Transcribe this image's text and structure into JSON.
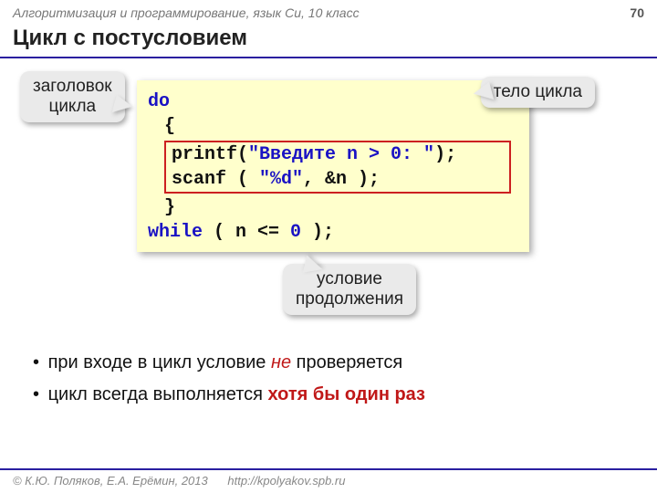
{
  "header": {
    "course": "Алгоритмизация и программирование, язык Си, 10 класс",
    "page": "70"
  },
  "title": "Цикл с постусловием",
  "callouts": {
    "left_l1": "заголовок",
    "left_l2": "цикла",
    "right": "тело цикла",
    "bottom_l1": "условие",
    "bottom_l2": "продолжения"
  },
  "code": {
    "do": "do",
    "ob": "{",
    "printf_a": "printf(",
    "printf_s": "\"Введите n > 0: \"",
    "printf_b": ");",
    "scanf_a": "scanf ( ",
    "scanf_s": "\"%d\"",
    "scanf_b": ", &n );",
    "cb": "}",
    "while": "while",
    "cond_a": " ( n <= ",
    "cond_n": "0",
    "cond_b": " );"
  },
  "bullets": {
    "b1_a": "при входе в цикл условие ",
    "b1_em": "не",
    "b1_b": " проверяется",
    "b2_a": "цикл всегда выполняется ",
    "b2_strong": "хотя бы один раз"
  },
  "footer": {
    "copyright": "© К.Ю. Поляков, Е.А. Ерёмин, 2013",
    "url": "http://kpolyakov.spb.ru"
  }
}
